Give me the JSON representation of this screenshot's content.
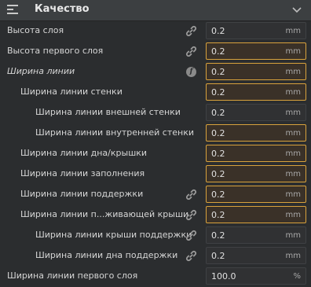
{
  "header": {
    "title": "Качество",
    "icon": "section-icon",
    "chevron": "chevron-down-icon"
  },
  "colors": {
    "warning_border": "#d8a23c",
    "panel": "#2b2d2f"
  },
  "rows": [
    {
      "label": "Высота слоя",
      "value": "0.2",
      "unit": "mm",
      "icon": "link-icon",
      "warn": false
    },
    {
      "label": "Высота первого слоя",
      "value": "0.2",
      "unit": "mm",
      "icon": "link-icon",
      "warn": true
    },
    {
      "label": "Ширина линии",
      "value": "0.2",
      "unit": "mm",
      "icon": "function-icon",
      "warn": true
    },
    {
      "label": "Ширина линии стенки",
      "value": "0.2",
      "unit": "mm",
      "warn": true
    },
    {
      "label": "Ширина линии внешней стенки",
      "value": "0.2",
      "unit": "mm",
      "warn": false
    },
    {
      "label": "Ширина линии внутренней стенки",
      "value": "0.2",
      "unit": "mm",
      "warn": true
    },
    {
      "label": "Ширина линии дна/крышки",
      "value": "0.2",
      "unit": "mm",
      "warn": true
    },
    {
      "label": "Ширина линии заполнения",
      "value": "0.2",
      "unit": "mm",
      "warn": true
    },
    {
      "label": "Ширина линии поддержки",
      "value": "0.2",
      "unit": "mm",
      "icon": "link-icon",
      "warn": true
    },
    {
      "label": "Ширина линии п...живающей крыши",
      "value": "0.2",
      "unit": "mm",
      "icon": "link-icon",
      "warn": true
    },
    {
      "label": "Ширина линии крыши поддержки",
      "value": "0.2",
      "unit": "mm",
      "icon": "link-icon",
      "warn": false
    },
    {
      "label": "Ширина линии дна поддержки",
      "value": "0.2",
      "unit": "mm",
      "icon": "link-icon",
      "warn": false
    },
    {
      "label": "Ширина линии первого слоя",
      "value": "100.0",
      "unit": "%",
      "warn": false
    }
  ]
}
